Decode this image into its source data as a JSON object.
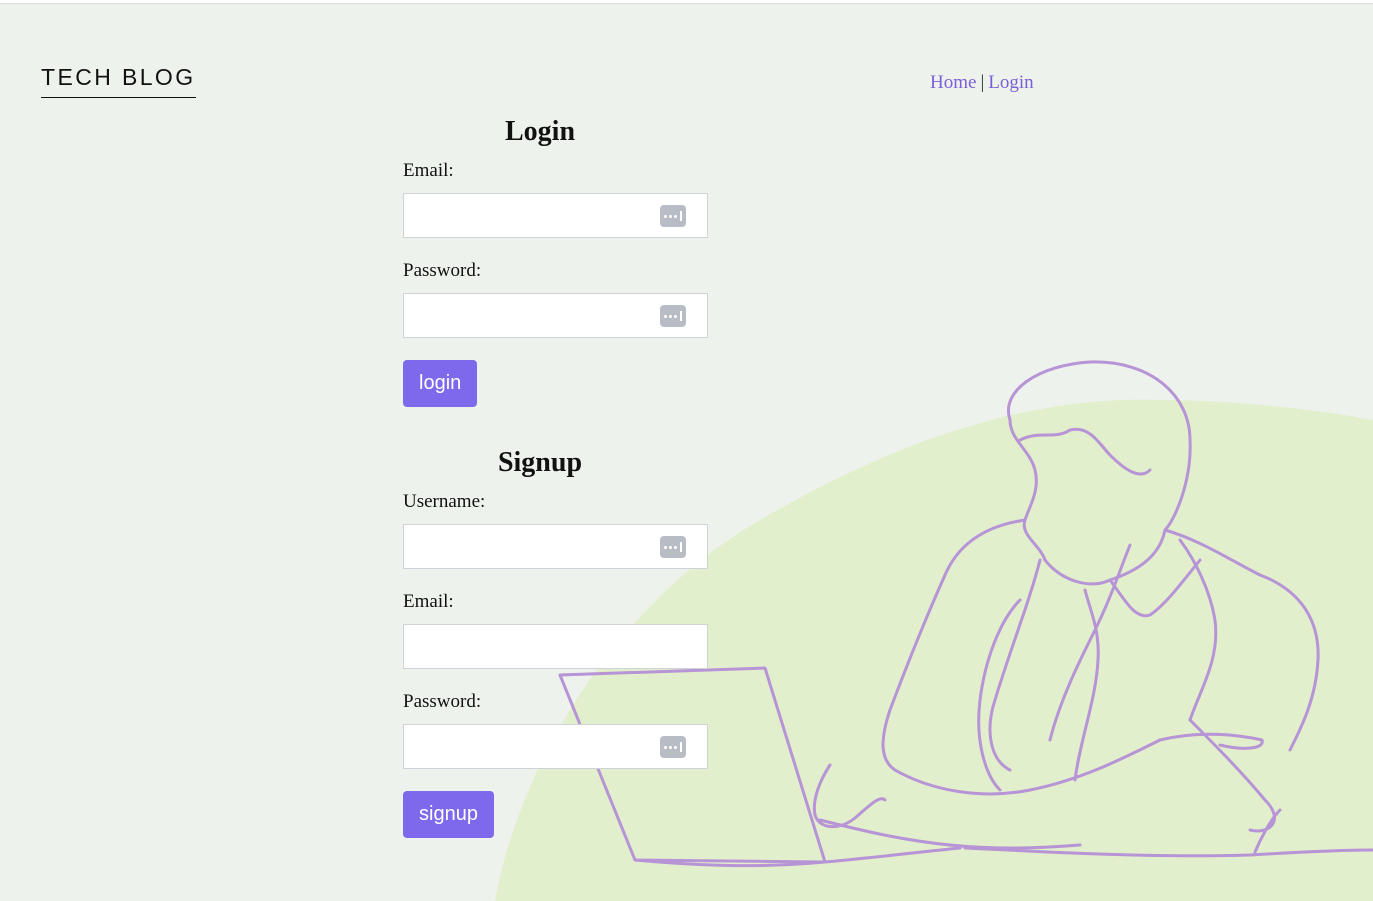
{
  "header": {
    "brand": "TECH BLOG",
    "nav": {
      "home": "Home",
      "separator": "|",
      "login": "Login"
    }
  },
  "login": {
    "title": "Login",
    "email_label": "Email:",
    "email_value": "",
    "password_label": "Password:",
    "password_value": "",
    "button": "login"
  },
  "signup": {
    "title": "Signup",
    "username_label": "Username:",
    "username_value": "",
    "email_label": "Email:",
    "email_value": "",
    "password_label": "Password:",
    "password_value": "",
    "button": "signup"
  },
  "icons": {
    "password_manager": "password-manager-icon",
    "illustration": "person-with-laptop-line-art"
  },
  "colors": {
    "accent": "#7e68ec",
    "link": "#7b5fd6",
    "illustration_line": "#b794d6",
    "blob": "#dfeec8",
    "background": "#eef2ec"
  }
}
